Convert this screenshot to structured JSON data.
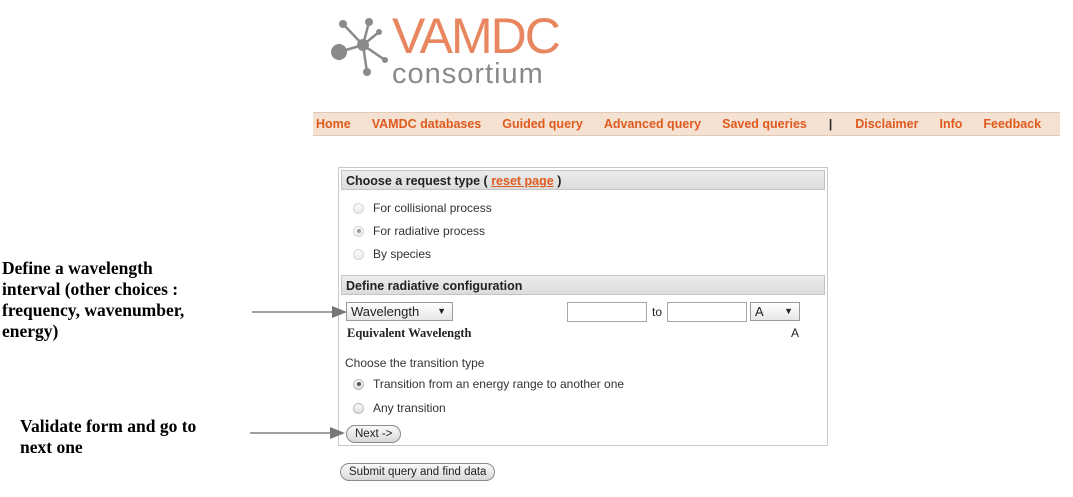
{
  "logo": {
    "word": "VAMDC",
    "sub": "consortium",
    "colors": {
      "accent": "#e8875f",
      "gray": "#8a8a8a"
    }
  },
  "nav": {
    "items": [
      "Home",
      "VAMDC databases",
      "Guided query",
      "Advanced query",
      "Saved queries"
    ],
    "separator": "|",
    "items2": [
      "Disclaimer",
      "Info",
      "Feedback"
    ]
  },
  "request": {
    "title": "Choose a request type (",
    "reset": "reset page",
    "title_end": ")",
    "options": [
      "For collisional process",
      "For radiative process",
      "By species"
    ],
    "selected_index": 1
  },
  "radiative": {
    "title": "Define radiative configuration",
    "quantity": "Wavelength",
    "from_value": "",
    "to_label": "to",
    "to_value": "",
    "unit": "A",
    "equivalent_label": "Equivalent Wavelength",
    "equivalent_unit": "A",
    "transition_label": "Choose the transition type",
    "transition_options": [
      "Transition from an energy range to another one",
      "Any transition"
    ],
    "transition_selected_index": 0,
    "next": "Next ->"
  },
  "submit": "Submit query and find data",
  "annotations": {
    "wavelength": [
      "Define a wavelength",
      "interval (other choices :",
      "frequency, wavenumber,",
      "energy)"
    ],
    "validate": [
      "Validate form and go to",
      "next one"
    ]
  }
}
